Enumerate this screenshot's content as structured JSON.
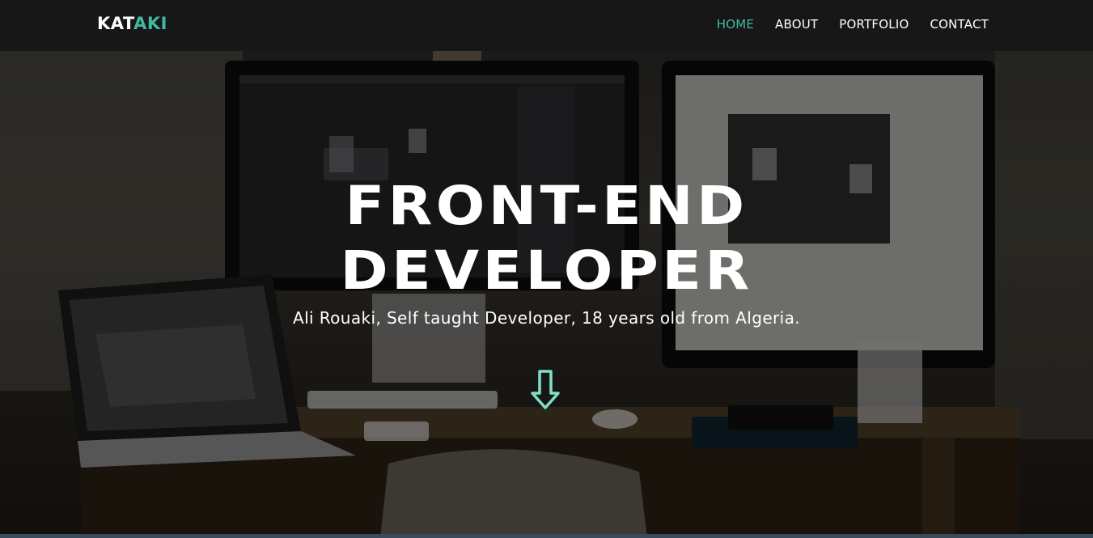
{
  "logo": {
    "prefix": "KAT",
    "accent": "AKI"
  },
  "nav": {
    "items": [
      {
        "label": "HOME",
        "active": true
      },
      {
        "label": "ABOUT",
        "active": false
      },
      {
        "label": "PORTFOLIO",
        "active": false
      },
      {
        "label": "CONTACT",
        "active": false
      }
    ]
  },
  "hero": {
    "headline_line1": "FRONT-END",
    "headline_line2": "DEVELOPER",
    "subtitle": "Ali Rouaki, Self taught Developer, 18 years old from Algeria.",
    "scroll_icon": "down-arrow-icon"
  },
  "colors": {
    "accent": "#3fb9a1",
    "navbar_bg": "#181717",
    "text": "#ffffff"
  }
}
